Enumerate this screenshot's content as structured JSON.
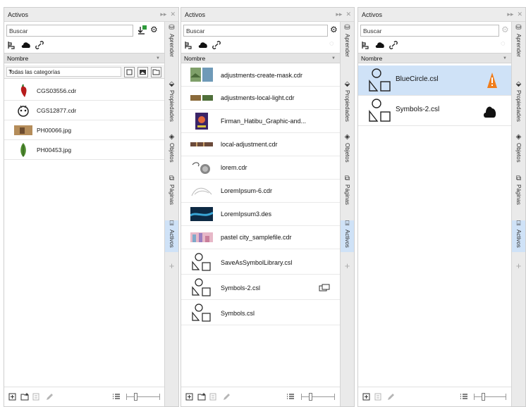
{
  "panel_title": "Activos",
  "search_placeholder": "Buscar",
  "sort_label": "Nombre",
  "category_label": "Todas las categorías",
  "rail_tabs": [
    "Aprender",
    "Propiedades",
    "Objetos",
    "Páginas",
    "Activos"
  ],
  "panel1_items": [
    {
      "name": "CGS03556.cdr",
      "icon": "chili-pepper-thumbnail"
    },
    {
      "name": "CGS12877.cdr",
      "icon": "cartoon-face-thumbnail"
    },
    {
      "name": "PH00066.jpg",
      "icon": "photo-thumbnail"
    },
    {
      "name": "PH00453.jpg",
      "icon": "plant-thumbnail"
    }
  ],
  "panel2_items": [
    {
      "name": "adjustments-create-mask.cdr",
      "icon": "landscape-thumbnail"
    },
    {
      "name": "adjustments-local-light.cdr",
      "icon": "dual-photo-thumbnail"
    },
    {
      "name": "Firman_Hatibu_Graphic-and...",
      "icon": "poster-thumbnail"
    },
    {
      "name": "local-adjustment.cdr",
      "icon": "strip-thumbnail"
    },
    {
      "name": "lorem.cdr",
      "icon": "swirl-thumbnail"
    },
    {
      "name": "LoremIpsum-6.cdr",
      "icon": "sketch-thumbnail"
    },
    {
      "name": "LoremIpsum3.des",
      "icon": "ocean-thumbnail"
    },
    {
      "name": "pastel city_samplefile.cdr",
      "icon": "city-thumbnail"
    },
    {
      "name": "SaveAsSymbolLibrary.csl",
      "icon": "symbol-library-icon"
    },
    {
      "name": "Symbols-2.csl",
      "icon": "symbol-library-icon",
      "badge": "linked-library-icon"
    },
    {
      "name": "Symbols.csl",
      "icon": "symbol-library-icon"
    }
  ],
  "panel3_items": [
    {
      "name": "BlueCircle.csl",
      "icon": "symbol-library-icon",
      "badge": "warning-icon",
      "badge_color": "#f07d1b",
      "selected": true
    },
    {
      "name": "Symbols-2.csl",
      "icon": "symbol-library-icon",
      "badge": "cloud-icon"
    }
  ],
  "colors": {
    "selection": "#cfe2f7",
    "warning": "#f07d1b",
    "import_accent": "#2e9a3b"
  }
}
